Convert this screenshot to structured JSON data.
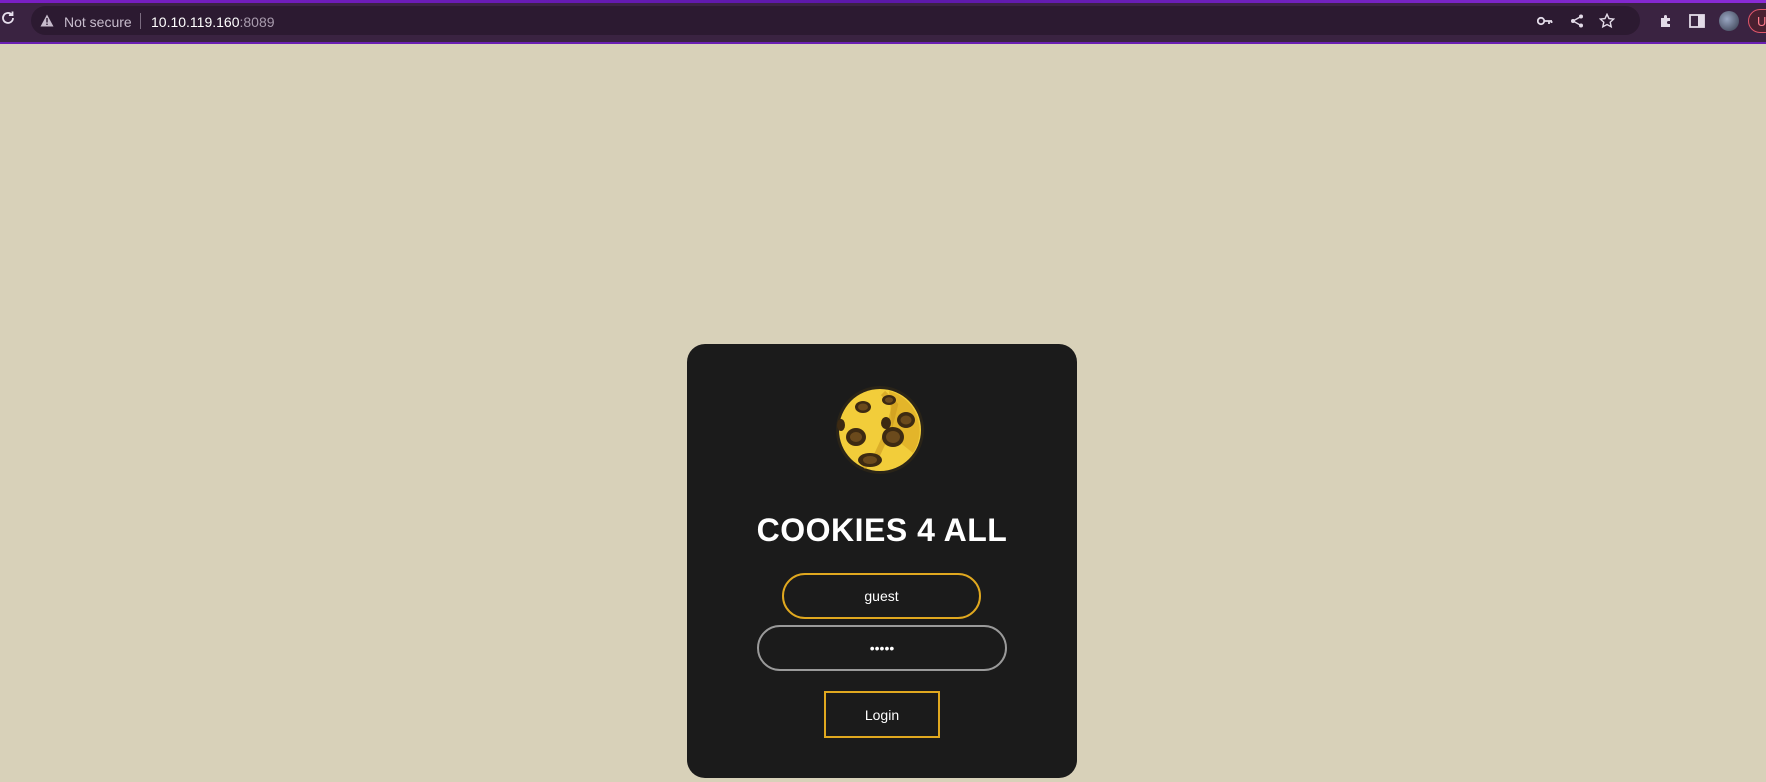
{
  "browser": {
    "security_label": "Not secure",
    "url_host": "10.10.119.160",
    "url_port": ":8089",
    "icons": [
      "reload-icon",
      "warning-icon",
      "key-icon",
      "share-icon",
      "star-icon",
      "extensions-icon",
      "side-panel-icon",
      "avatar",
      "profile-chip"
    ],
    "profile_chip_text": "U"
  },
  "login": {
    "title": "COOKIES 4 ALL",
    "username_value": "guest",
    "password_value": "•••••",
    "button_label": "Login",
    "accent_color": "#e0a81f",
    "card_color": "#1b1b1b",
    "page_background": "#d8d1b9"
  }
}
